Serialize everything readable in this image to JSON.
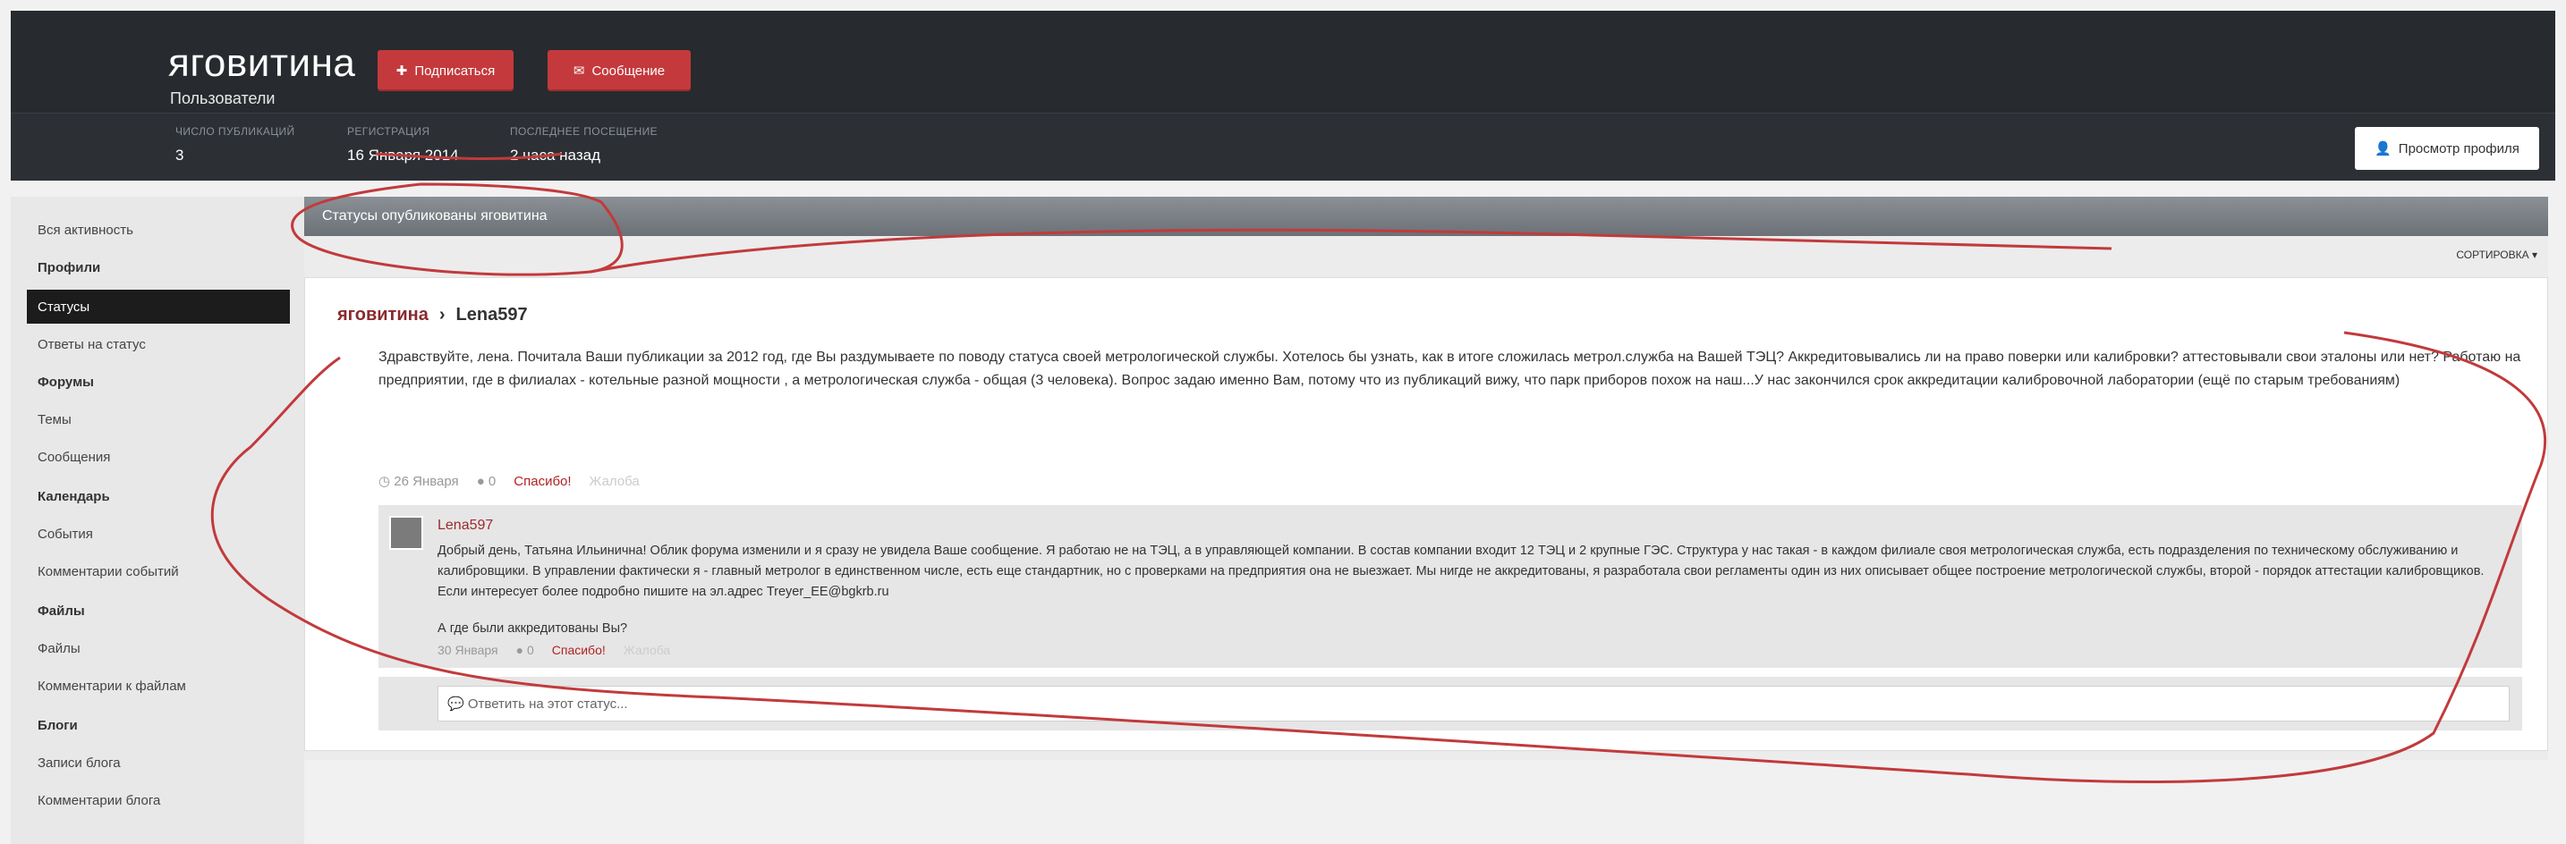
{
  "profile": {
    "name": "яговитина",
    "group": "Пользователи",
    "subscribe_label": "Подписаться",
    "message_label": "Сообщение",
    "view_profile_label": "Просмотр профиля",
    "stats": [
      {
        "label": "Число публикаций",
        "value": "3"
      },
      {
        "label": "Регистрация",
        "value": "16 Января 2014"
      },
      {
        "label": "Последнее посещение",
        "value": "2 часа назад"
      }
    ]
  },
  "sidebar": {
    "items": [
      {
        "label": "Вся активность",
        "type": "link"
      },
      {
        "label": "Профили",
        "type": "header"
      },
      {
        "label": "Статусы",
        "type": "active"
      },
      {
        "label": "Ответы на статус",
        "type": "link"
      },
      {
        "label": "Форумы",
        "type": "header"
      },
      {
        "label": "Темы",
        "type": "link"
      },
      {
        "label": "Сообщения",
        "type": "link"
      },
      {
        "label": "Календарь",
        "type": "header"
      },
      {
        "label": "События",
        "type": "link"
      },
      {
        "label": "Комментарии событий",
        "type": "link"
      },
      {
        "label": "Файлы",
        "type": "header"
      },
      {
        "label": "Файлы",
        "type": "link"
      },
      {
        "label": "Комментарии к файлам",
        "type": "link"
      },
      {
        "label": "Блоги",
        "type": "header"
      },
      {
        "label": "Записи блога",
        "type": "link"
      },
      {
        "label": "Комментарии блога",
        "type": "link"
      }
    ]
  },
  "main": {
    "panel_title": "Статусы опубликованы яговитина",
    "sort_label": "Сортировка",
    "status": {
      "author": "яговитина",
      "recipient": "Lena597",
      "text": "Здравствуйте, лена.  Почитала Ваши публикации за 2012 год, где Вы раздумываете по поводу статуса своей метрологической службы. Хотелось бы узнать, как в итоге сложилась метрол.служба на Вашей ТЭЦ? Аккредитовывались ли на право поверки или калибровки? аттестовывали свои эталоны или нет? Работаю на предприятии, где в филиалах - котельные разной мощности , а метрологическая служба  - общая (3 человека). Вопрос задаю именно Вам, потому что из публикаций вижу, что парк приборов похож на наш...У нас закончился срок аккредитации калибровочной лаборатории (ещё по старым требованиям)",
      "date": "26 Января",
      "likes": "0",
      "thanks_label": "Спасибо!",
      "report_label": "Жалоба"
    },
    "comment": {
      "author": "Lena597",
      "text": "Добрый день, Татьяна Ильинична! Облик форума изменили и я сразу не увидела Ваше сообщение. Я работаю не на ТЭЦ, а в  управляющей компании. В состав компании входит 12 ТЭЦ и 2 крупные ГЭС. Структура у нас такая - в каждом филиале своя метрологическая служба, есть подразделения по техническому обслуживанию и калибровщики. В управлении фактически я - главный метролог в единственном числе, есть еще стандартник, но с проверками на предприятия она не выезжает. Мы нигде не аккредитованы, я разработала свои регламенты один из них описывает общее построение метрологической службы, второй - порядок аттестации калибровщиков. Если интересует более подробно пишите на эл.адрес Treyer_EE@bgkrb.ru",
      "question": "А где были аккредитованы Вы?",
      "date": "30 Января",
      "likes": "0",
      "thanks_label": "Спасибо!",
      "report_label": "Жалоба"
    },
    "reply_placeholder": "Ответить на этот статус..."
  },
  "colors": {
    "header_bg": "#2c3035",
    "button_red": "#c4393c",
    "sidebar_active": "#1c1c1c",
    "annotation": "#c23a3c"
  }
}
